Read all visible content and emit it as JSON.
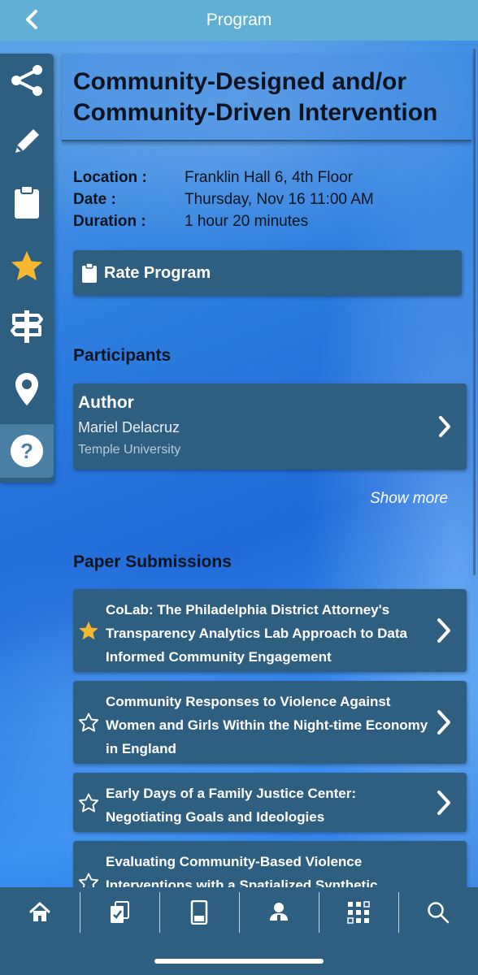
{
  "topbar": {
    "title": "Program",
    "back_icon": "chevron-left-icon"
  },
  "rail": {
    "items": [
      {
        "name": "share-icon"
      },
      {
        "name": "pencil-icon"
      },
      {
        "name": "clipboard-icon"
      },
      {
        "name": "star-icon",
        "color": "#f5b82e"
      },
      {
        "name": "signpost-icon"
      },
      {
        "name": "location-pin-icon"
      },
      {
        "name": "help-icon"
      }
    ]
  },
  "program": {
    "title": "Community-Designed and/or Community-Driven Intervention",
    "location_label": "Location :",
    "location_value": "Franklin Hall 6, 4th Floor",
    "date_label": "Date :",
    "date_value": "Thursday, Nov 16 11:00 AM",
    "duration_label": "Duration :",
    "duration_value": "1 hour 20 minutes",
    "rate_label": "Rate Program"
  },
  "participants": {
    "heading": "Participants",
    "items": [
      {
        "role": "Author",
        "name": "Mariel Delacruz",
        "org": "Temple University"
      }
    ],
    "show_more": "Show more"
  },
  "papers": {
    "heading": "Paper Submissions",
    "items": [
      {
        "title": "CoLab: The Philadelphia District Attorney's Transparency Analytics Lab Approach to Data Informed Community Engagement",
        "starred": true
      },
      {
        "title": "Community Responses to Violence Against Women and Girls Within the Night-time Economy in England",
        "starred": false
      },
      {
        "title": "Early Days of a Family Justice Center: Negotiating Goals and Ideologies",
        "starred": false
      },
      {
        "title": "Evaluating Community-Based Violence Interventions with a Spatialized Synthetic",
        "starred": false
      }
    ]
  },
  "bottom_tabs": [
    {
      "name": "home-icon"
    },
    {
      "name": "checklist-icon"
    },
    {
      "name": "kiosk-icon"
    },
    {
      "name": "speaker-icon"
    },
    {
      "name": "grid-icon"
    },
    {
      "name": "search-icon"
    }
  ],
  "colors": {
    "panel": "#2e5f80",
    "topbar": "#5fb0d4",
    "accent_star": "#f5b82e"
  }
}
